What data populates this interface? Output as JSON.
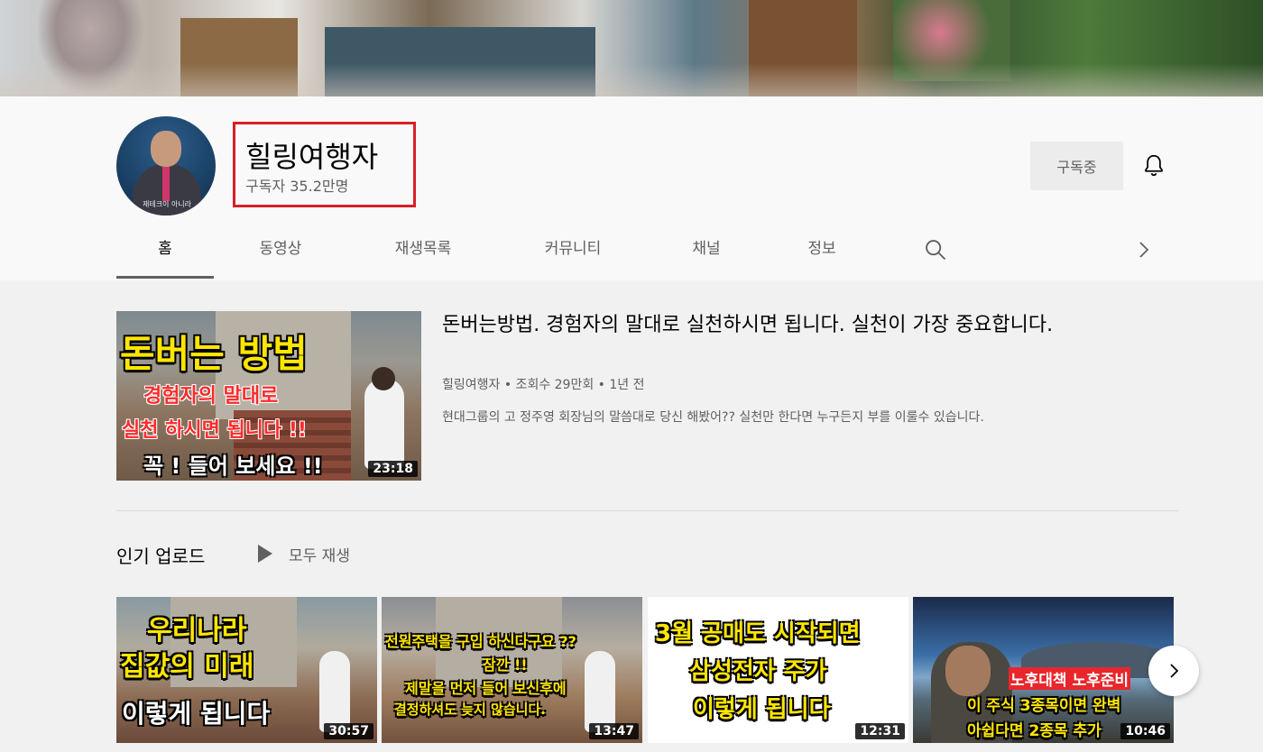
{
  "channel": {
    "name": "힐링여행자",
    "subscribers": "구독자 35.2만명",
    "avatar_caption": "재테크이 아니라"
  },
  "actions": {
    "subscribe_label": "구독중",
    "bell_icon": "bell-icon"
  },
  "tabs": [
    {
      "label": "홈",
      "active": true
    },
    {
      "label": "동영상"
    },
    {
      "label": "재생목록"
    },
    {
      "label": "커뮤니티"
    },
    {
      "label": "채널"
    },
    {
      "label": "정보"
    }
  ],
  "featured": {
    "title": "돈버는방법. 경험자의 말대로 실천하시면 됩니다. 실천이 가장 중요합니다.",
    "meta": "힐링여행자 • 조회수 29만회 • 1년 전",
    "description": "현대그룹의 고 정주영 회장님의 말씀대로 당신 해봤어?? 실천만 한다면 누구든지 부를 이룰수 있습니다.",
    "duration": "23:18",
    "thumb_lines": [
      "돈버는 방법",
      "경험자의 말대로",
      "실천 하시면 됩니다 !!",
      "꼭 ! 들어 보세요 !!"
    ]
  },
  "shelf": {
    "title": "인기 업로드",
    "play_all": "모두 재생",
    "videos": [
      {
        "duration": "30:57",
        "thumb_lines": [
          "우리나라",
          "집값의 미래",
          "이렇게 됩니다"
        ]
      },
      {
        "duration": "13:47",
        "thumb_lines": [
          "전원주택을 구입 하신다구요 ??",
          "잠깐 !!",
          "제말을 먼저 들어 보신후에",
          "결정하셔도 늦지 않습니다."
        ]
      },
      {
        "duration": "12:31",
        "thumb_lines": [
          "3월 공매도 시작되면",
          "삼성전자 주가",
          "이렇게 됩니다"
        ]
      },
      {
        "duration": "10:46",
        "thumb_lines": [
          "노후대책 노후준비",
          "이 주식 3종목이면 완벽",
          "아쉽다면 2종목 추가"
        ]
      }
    ]
  },
  "colors": {
    "highlight_box": "#d81f26",
    "thumb_yellow": "#ffe600",
    "thumb_red": "#ff2a2a"
  }
}
